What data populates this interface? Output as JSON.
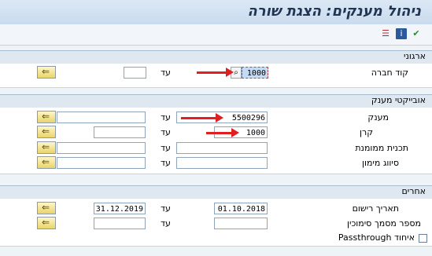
{
  "title": "ניהול מענקים: הצגת שורה",
  "toolbar": {
    "icons": [
      "execute-icon",
      "info-icon",
      "variant-icon"
    ]
  },
  "sections": {
    "org": {
      "title": "ארגוני",
      "rows": [
        {
          "label": "קוד חברה",
          "from": "1000",
          "to": "",
          "to_label": "עד"
        }
      ]
    },
    "grant_objects": {
      "title": "אובייקטי מענק",
      "rows": [
        {
          "label": "מענק",
          "from": "5500296",
          "to": "",
          "to_label": "עד"
        },
        {
          "label": "קרן",
          "from": "1000",
          "to": "",
          "to_label": "עד"
        },
        {
          "label": "תכנית ממומנת",
          "from": "",
          "to": "",
          "to_label": "עד"
        },
        {
          "label": "סיווג מימון",
          "from": "",
          "to": "",
          "to_label": "עד"
        }
      ]
    },
    "other": {
      "title": "אחרים",
      "rows": [
        {
          "label": "תאריך רישום",
          "from": "01.10.2018",
          "to": "31.12.2019",
          "to_label": "עד"
        },
        {
          "label": "מספר מסמך סימוכין",
          "from": "",
          "to": "",
          "to_label": "עד"
        }
      ],
      "checkbox_label": "איחוד Passthrough"
    }
  }
}
